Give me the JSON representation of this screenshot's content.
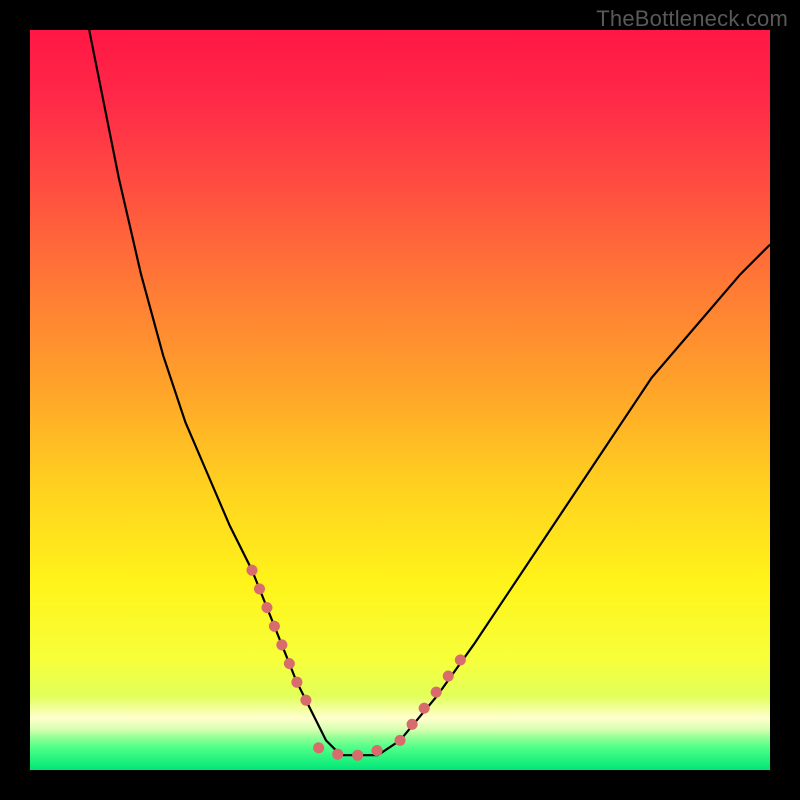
{
  "watermark": "TheBottleneck.com",
  "chart_data": {
    "type": "line",
    "title": "",
    "xlabel": "",
    "ylabel": "",
    "xlim": [
      0,
      100
    ],
    "ylim": [
      0,
      100
    ],
    "grid": false,
    "legend": false,
    "gradient_stops": [
      {
        "offset": 0.0,
        "color": "#ff1744"
      },
      {
        "offset": 0.1,
        "color": "#ff2b48"
      },
      {
        "offset": 0.22,
        "color": "#ff5040"
      },
      {
        "offset": 0.35,
        "color": "#ff7b35"
      },
      {
        "offset": 0.48,
        "color": "#ffa22a"
      },
      {
        "offset": 0.62,
        "color": "#ffd21f"
      },
      {
        "offset": 0.75,
        "color": "#fff41a"
      },
      {
        "offset": 0.85,
        "color": "#f7ff3a"
      },
      {
        "offset": 0.9,
        "color": "#e2ff5a"
      },
      {
        "offset": 0.93,
        "color": "#ffffcd"
      },
      {
        "offset": 0.945,
        "color": "#d7ffb0"
      },
      {
        "offset": 0.955,
        "color": "#98ff98"
      },
      {
        "offset": 0.97,
        "color": "#4dff88"
      },
      {
        "offset": 1.0,
        "color": "#00e676"
      }
    ],
    "series": [
      {
        "name": "main-curve",
        "color": "#000000",
        "width": 2.2,
        "x": [
          8,
          10,
          12,
          15,
          18,
          21,
          24,
          27,
          30,
          32,
          34,
          36,
          38,
          40,
          42,
          44,
          47,
          50,
          55,
          60,
          66,
          72,
          78,
          84,
          90,
          96,
          100
        ],
        "y": [
          100,
          90,
          80,
          67,
          56,
          47,
          40,
          33,
          27,
          22,
          17,
          12,
          8,
          4,
          2,
          2,
          2,
          4,
          10,
          17,
          26,
          35,
          44,
          53,
          60,
          67,
          71
        ]
      },
      {
        "name": "highlight-left",
        "color": "#d86b6b",
        "width": 11,
        "linecap": "round",
        "dash": "0.1 20",
        "x": [
          30,
          32,
          34,
          36,
          38
        ],
        "y": [
          27,
          22,
          17,
          12,
          8
        ]
      },
      {
        "name": "highlight-bottom",
        "color": "#d86b6b",
        "width": 11,
        "linecap": "round",
        "dash": "0.1 20",
        "x": [
          39,
          42,
          45,
          48
        ],
        "y": [
          3,
          2,
          2,
          3
        ]
      },
      {
        "name": "highlight-right",
        "color": "#d86b6b",
        "width": 11,
        "linecap": "round",
        "dash": "0.1 20",
        "x": [
          50,
          53,
          56,
          59
        ],
        "y": [
          4,
          8,
          12,
          16
        ]
      }
    ]
  }
}
